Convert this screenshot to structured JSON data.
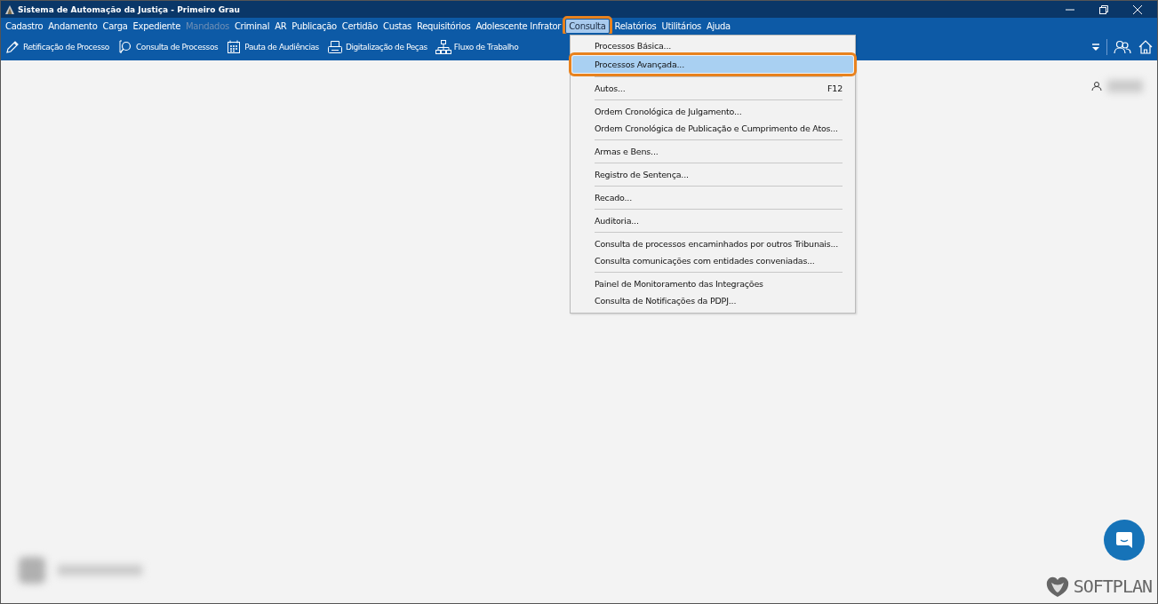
{
  "window": {
    "title": "Sistema de Automação da Justiça - Primeiro Grau"
  },
  "menu_bar": [
    {
      "label": "Cadastro",
      "disabled": false,
      "selected": false
    },
    {
      "label": "Andamento",
      "disabled": false,
      "selected": false
    },
    {
      "label": "Carga",
      "disabled": false,
      "selected": false
    },
    {
      "label": "Expediente",
      "disabled": false,
      "selected": false
    },
    {
      "label": "Mandados",
      "disabled": true,
      "selected": false
    },
    {
      "label": "Criminal",
      "disabled": false,
      "selected": false
    },
    {
      "label": "AR",
      "disabled": false,
      "selected": false
    },
    {
      "label": "Publicação",
      "disabled": false,
      "selected": false
    },
    {
      "label": "Certidão",
      "disabled": false,
      "selected": false
    },
    {
      "label": "Custas",
      "disabled": false,
      "selected": false
    },
    {
      "label": "Requisitórios",
      "disabled": false,
      "selected": false
    },
    {
      "label": "Adolescente Infrator",
      "disabled": false,
      "selected": false
    },
    {
      "label": "Consulta",
      "disabled": false,
      "selected": true
    },
    {
      "label": "Relatórios",
      "disabled": false,
      "selected": false
    },
    {
      "label": "Utilitários",
      "disabled": false,
      "selected": false
    },
    {
      "label": "Ajuda",
      "disabled": false,
      "selected": false
    }
  ],
  "toolbar": [
    {
      "label": "Retificação de Processo",
      "kind": "edit"
    },
    {
      "label": "Consulta de Processos",
      "kind": "search"
    },
    {
      "label": "Pauta de Audiências",
      "kind": "calendar"
    },
    {
      "label": "Digitalização de Peças",
      "kind": "scanner"
    },
    {
      "label": "Fluxo de Trabalho",
      "kind": "flow"
    }
  ],
  "dropdown": [
    {
      "kind": "item",
      "label": "Processos Básica...",
      "selected": false
    },
    {
      "kind": "item",
      "label": "Processos Avançada...",
      "selected": true
    },
    {
      "kind": "separator"
    },
    {
      "kind": "item",
      "label": "Autos...",
      "shortcut": "F12",
      "selected": false
    },
    {
      "kind": "separator"
    },
    {
      "kind": "item",
      "label": "Ordem Cronológica de Julgamento...",
      "selected": false
    },
    {
      "kind": "item",
      "label": "Ordem Cronológica de Publicação e Cumprimento de Atos...",
      "selected": false
    },
    {
      "kind": "separator"
    },
    {
      "kind": "item",
      "label": "Armas e Bens...",
      "selected": false
    },
    {
      "kind": "separator"
    },
    {
      "kind": "item",
      "label": "Registro de Sentença...",
      "selected": false
    },
    {
      "kind": "separator"
    },
    {
      "kind": "item",
      "label": "Recado...",
      "selected": false
    },
    {
      "kind": "separator"
    },
    {
      "kind": "item",
      "label": "Auditoria...",
      "selected": false
    },
    {
      "kind": "separator"
    },
    {
      "kind": "item",
      "label": "Consulta de processos encaminhados por outros Tribunais...",
      "selected": false
    },
    {
      "kind": "item",
      "label": "Consulta comunicações com entidades conveniadas...",
      "selected": false
    },
    {
      "kind": "separator"
    },
    {
      "kind": "item",
      "label": "Painel de Monitoramento das Integrações",
      "selected": false
    },
    {
      "kind": "item",
      "label": "Consulta de Notificações da PDPJ...",
      "selected": false
    }
  ],
  "footer": {
    "brand": "SOFTPLAN"
  }
}
